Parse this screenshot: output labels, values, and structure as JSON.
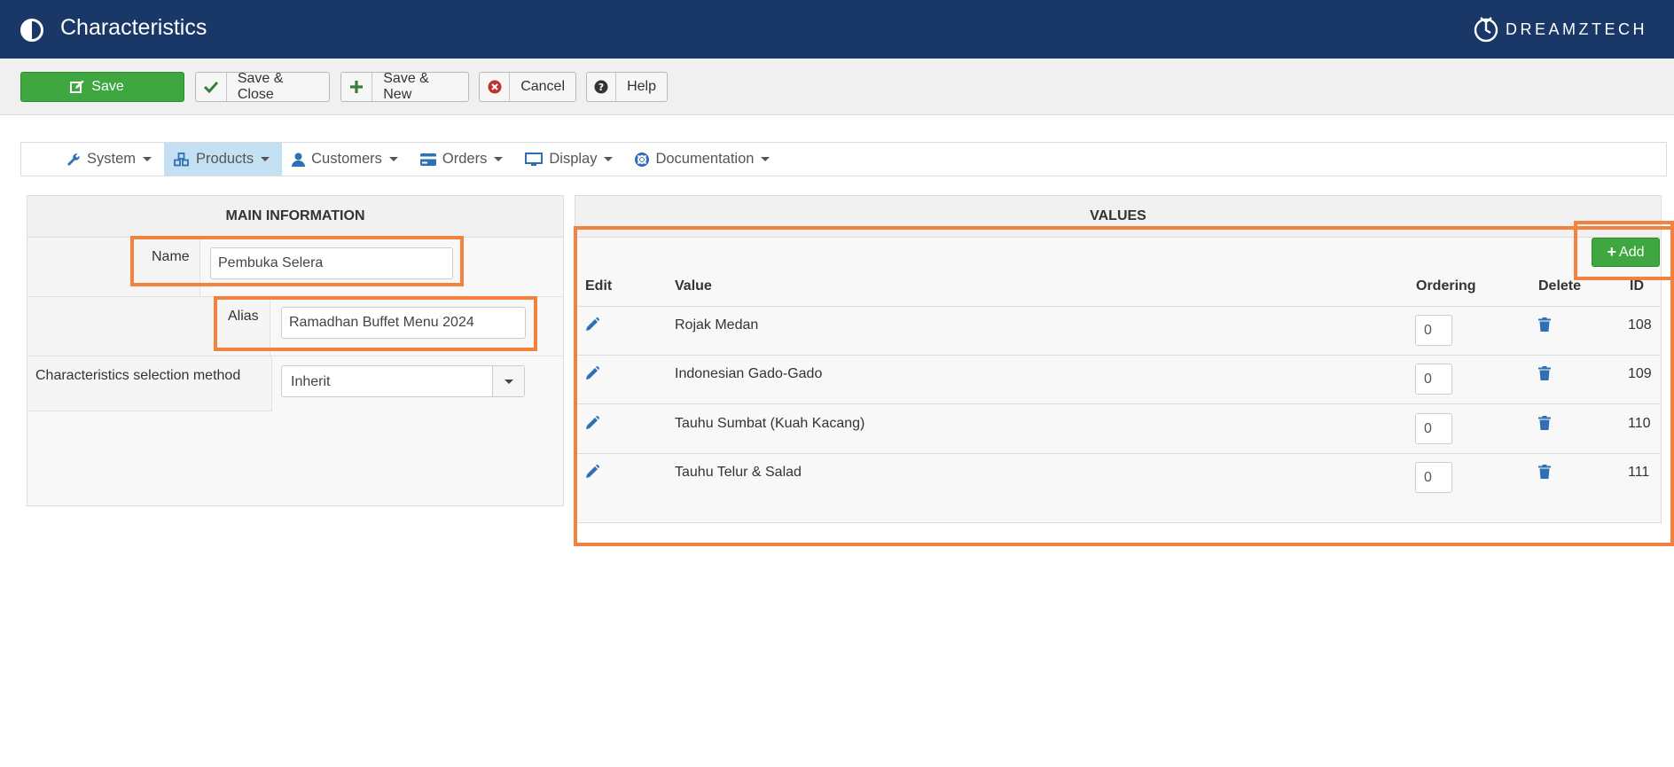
{
  "header": {
    "title": "Characteristics",
    "brand": "DREAMZTECH"
  },
  "toolbar": {
    "save": "Save",
    "save_close": "Save & Close",
    "save_new": "Save & New",
    "cancel": "Cancel",
    "help": "Help"
  },
  "menu": {
    "items": [
      {
        "label": "System",
        "icon": "wrench-icon"
      },
      {
        "label": "Products",
        "icon": "cubes-icon",
        "active": true
      },
      {
        "label": "Customers",
        "icon": "user-icon"
      },
      {
        "label": "Orders",
        "icon": "credit-card-icon"
      },
      {
        "label": "Display",
        "icon": "monitor-icon"
      },
      {
        "label": "Documentation",
        "icon": "lifebuoy-icon"
      }
    ]
  },
  "main_info": {
    "heading": "MAIN INFORMATION",
    "name_label": "Name",
    "name_value": "Pembuka Selera",
    "alias_label": "Alias",
    "alias_value": "Ramadhan Buffet Menu 2024",
    "method_label": "Characteristics selection method",
    "method_value": "Inherit"
  },
  "values": {
    "heading": "VALUES",
    "add_label": "Add",
    "columns": {
      "edit": "Edit",
      "value": "Value",
      "ordering": "Ordering",
      "delete": "Delete",
      "id": "ID"
    },
    "rows": [
      {
        "value": "Rojak Medan",
        "ordering": "0",
        "id": "108"
      },
      {
        "value": "Indonesian Gado-Gado",
        "ordering": "0",
        "id": "109"
      },
      {
        "value": "Tauhu Sumbat (Kuah Kacang)",
        "ordering": "0",
        "id": "110"
      },
      {
        "value": "Tauhu Telur & Salad",
        "ordering": "0",
        "id": "111"
      }
    ]
  },
  "colors": {
    "header": "#1a3867",
    "success": "#3ea740",
    "highlight": "#f4823f",
    "icon_blue": "#2f6fb3",
    "menu_active": "#c4e1f3"
  }
}
